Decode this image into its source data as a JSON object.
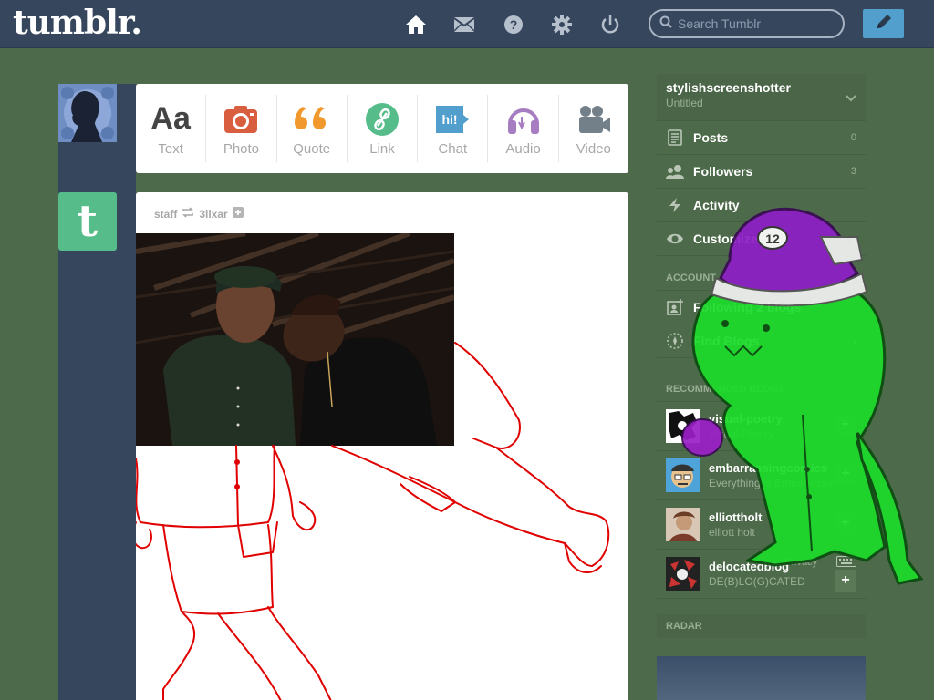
{
  "header": {
    "logo": "tumblr.",
    "icons": [
      "home-icon",
      "inbox-icon",
      "help-icon",
      "settings-icon",
      "logout-icon"
    ],
    "search_placeholder": "Search Tumblr",
    "compose_icon": "pencil-icon"
  },
  "post_types": [
    {
      "label": "Text",
      "icon": "text-icon",
      "color": "#444444"
    },
    {
      "label": "Photo",
      "icon": "camera-icon",
      "color": "#d95e40"
    },
    {
      "label": "Quote",
      "icon": "quote-icon",
      "color": "#f2992e"
    },
    {
      "label": "Link",
      "icon": "link-icon",
      "color": "#56bc8a"
    },
    {
      "label": "Chat",
      "icon": "chat-icon",
      "color": "#529ecc"
    },
    {
      "label": "Audio",
      "icon": "headphones-icon",
      "color": "#a77dc2"
    },
    {
      "label": "Video",
      "icon": "video-camera-icon",
      "color": "#748089"
    }
  ],
  "post": {
    "author": "staff",
    "reblogged_from": "3llxar"
  },
  "sidebar": {
    "blog_name": "stylishscreenshotter",
    "blog_subtitle": "Untitled",
    "items": [
      {
        "label": "Posts",
        "count": "0",
        "icon": "posts-icon"
      },
      {
        "label": "Followers",
        "count": "3",
        "icon": "followers-icon"
      },
      {
        "label": "Activity",
        "count": "",
        "icon": "activity-icon"
      },
      {
        "label": "Customize",
        "count": "",
        "icon": "eye-icon"
      }
    ],
    "account_title": "ACCOUNT",
    "account_items": [
      {
        "label": "Following 2 blogs",
        "icon": "following-icon"
      },
      {
        "label": "Find Blogs",
        "icon": "compass-icon"
      }
    ],
    "recommended_title": "RECOMMENDED BLOGS",
    "recommended": [
      {
        "name": "visual-poetry",
        "desc": "Visual-Poetry"
      },
      {
        "name": "embarrassingcomics",
        "desc": "Everything is Embarrassing"
      },
      {
        "name": "elliottholt",
        "desc": "elliott holt"
      },
      {
        "name": "delocatedblog",
        "desc": "DE(B)LO(G)CATED"
      }
    ],
    "privacy_text": "Privacy",
    "radar_title": "RADAR"
  }
}
